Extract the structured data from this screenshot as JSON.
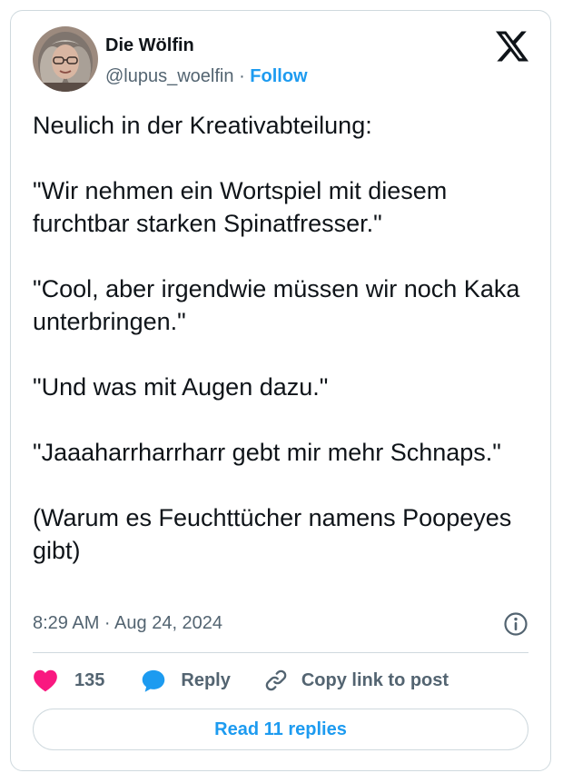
{
  "author": {
    "name": "Die Wölfin",
    "handle": "@lupus_woelfin",
    "separator": "·",
    "follow_label": "Follow",
    "avatar_icon": "profile-photo"
  },
  "header": {
    "logo_icon": "x-logo-icon"
  },
  "tweet": {
    "text": "Neulich in der Kreativabteilung:\n\n\"Wir nehmen ein Wortspiel mit diesem furchtbar starken Spinatfresser.\"\n\n\"Cool, aber irgendwie müssen wir noch Kaka unterbringen.\"\n\n\"Und was mit Augen dazu.\"\n\n\"Jaaaharrharrharr gebt mir mehr Schnaps.\"\n\n(Warum es Feuchttücher namens Poopeyes gibt)",
    "timestamp": "8:29 AM · Aug 24, 2024",
    "info_icon": "info-icon"
  },
  "actions": {
    "like_count": "135",
    "reply_label": "Reply",
    "copy_label": "Copy link to post",
    "like_color": "#f91880",
    "reply_color": "#1d9bf0"
  },
  "footer": {
    "read_replies_label": "Read 11 replies"
  },
  "colors": {
    "accent": "#1d9bf0",
    "text": "#0f1419",
    "muted": "#536471",
    "border": "#cfd9de"
  }
}
